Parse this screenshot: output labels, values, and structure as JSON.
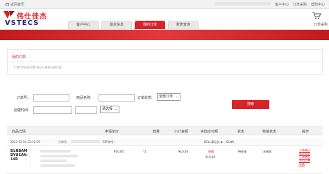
{
  "topbar": {
    "home_label": "返回首页",
    "links": [
      "客户中心",
      "帮助中心"
    ]
  },
  "logo": {
    "cn": "伟仕佳杰",
    "en": "VSTECS"
  },
  "cart": {
    "top_label": "订单采购",
    "header_label": "订单采购"
  },
  "tabs": [
    {
      "label": "客户中心",
      "active": false
    },
    {
      "label": "基本信息",
      "active": false
    },
    {
      "label": "我的订单",
      "active": true
    },
    {
      "label": "账表查询",
      "active": false
    }
  ],
  "panel": {
    "title": "我的订单",
    "note": "*订单\"实际应付额\"请以订单恰价格为准"
  },
  "search": {
    "order_no_label": "订单号:",
    "product_name_label": "商品名称:",
    "order_status_label": "订单状态:",
    "order_status_value": "全部订单",
    "created_label": "创建时间:",
    "period_value": "请选择",
    "button_label": "搜索"
  },
  "table": {
    "headers": [
      "商品详情",
      "申请单价",
      "数量",
      "小计金额",
      "实际应付额",
      "状态",
      "核销状态",
      "操作"
    ]
  },
  "order": {
    "time": "2021-03-04 12:11:59",
    "order_label": "订单号:",
    "erp_label": "ERP单号:",
    "company": "DELL事业部",
    "brand": "DLNB",
    "product_name": "DLNBAMDYUSAN-14R",
    "unit_price": "¥10.00",
    "qty": "*1",
    "subtotal": "¥10.00",
    "paid_label": "银稿",
    "paid_amount": "¥10.00",
    "status": "待处理",
    "writeoff": "未核销",
    "ops": [
      "订单确认",
      "再次发起",
      "订单商品",
      "交付订单",
      "详情"
    ]
  },
  "colors": {
    "brand_red": "#d8232a",
    "logo_navy": "#1f2a6b"
  }
}
